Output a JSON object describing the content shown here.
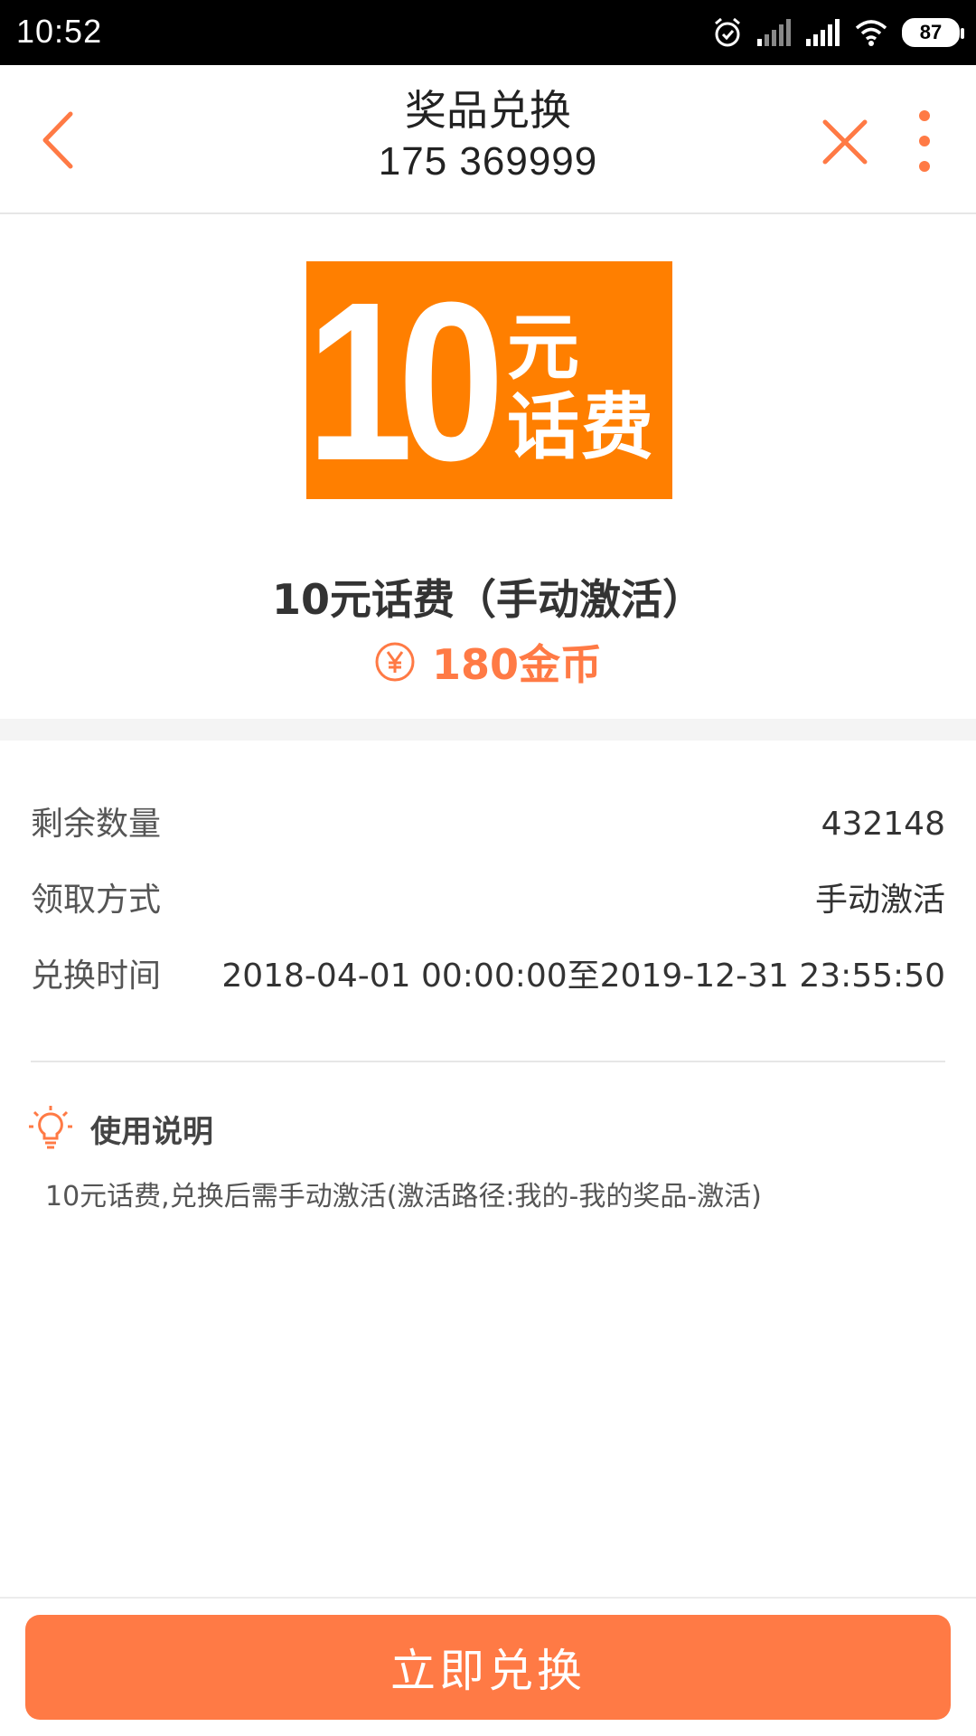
{
  "status_bar": {
    "time": "10:52",
    "battery": "87",
    "icons": [
      "alarm-icon",
      "signal-1-icon",
      "signal-2-icon",
      "wifi-icon",
      "battery-icon"
    ]
  },
  "header": {
    "title": "奖品兑换",
    "subtitle": "175 369999",
    "icons": [
      "back-arrow-icon",
      "close-icon",
      "more-vertical-icon"
    ],
    "accent_color": "#ff7a45"
  },
  "prize": {
    "image": {
      "number": "10",
      "unit": "元",
      "label": "话费",
      "background_color": "#ff7f00"
    },
    "name": "10元话费（手动激活）",
    "price": "180金币",
    "price_icon": "yen-coin-icon"
  },
  "details": [
    {
      "label": "剩余数量",
      "value": "432148"
    },
    {
      "label": "领取方式",
      "value": "手动激活"
    },
    {
      "label": "兑换时间",
      "value": "2018-04-01 00:00:00至2019-12-31 23:55:50"
    }
  ],
  "usage": {
    "icon": "lightbulb-icon",
    "title": "使用说明",
    "text": "10元话费,兑换后需手动激活(激活路径:我的-我的奖品-激活)"
  },
  "footer": {
    "button_label": "立即兑换",
    "button_color": "#ff7a45"
  }
}
